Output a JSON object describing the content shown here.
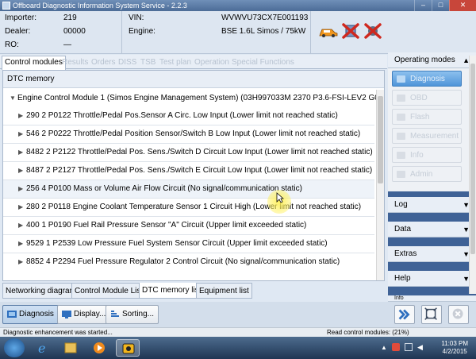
{
  "window": {
    "title": "Offboard Diagnostic Information System Service - 2.2.3",
    "minimize": "–",
    "maximize": "□",
    "close": "✕"
  },
  "header": {
    "importer_label": "Importer:",
    "importer_value": "219",
    "dealer_label": "Dealer:",
    "dealer_value": "00000",
    "ro_label": "RO:",
    "ro_value": "—",
    "vin_label": "VIN:",
    "vin_value": "WVWVU73CX7E001193",
    "engine_label": "Engine:",
    "engine_value": "BSE 1.6L Simos / 75kW"
  },
  "tabs": [
    {
      "label": "Control modules",
      "active": true
    },
    {
      "label": "Results",
      "active": false
    },
    {
      "label": "Orders",
      "active": false
    },
    {
      "label": "DISS",
      "active": false
    },
    {
      "label": "TSB",
      "active": false
    },
    {
      "label": "Test plan",
      "active": false
    },
    {
      "label": "Operation",
      "active": false
    },
    {
      "label": "Special Functions",
      "active": false
    }
  ],
  "main": {
    "section_title": "DTC memory",
    "module": "Engine Control Module 1 (Simos Engine Management System) (03H997033M      2370   P3.6-FSI-LEV2  G00",
    "dtcs": [
      {
        "text": "290  2   P0122   Throttle/Pedal Pos.Sensor A Circ. Low Input  (Lower limit not reached   static)"
      },
      {
        "text": "546  2   P0222   Throttle/Pedal Position Sensor/Switch B          Low Input  (Lower limit not reached   static)"
      },
      {
        "text": "8482  2   P2122   Throttle/Pedal Pos. Sens./Switch D Circuit Low Input  (Lower limit not reached   static)"
      },
      {
        "text": "8487  2   P2127   Throttle/Pedal Pos. Sens./Switch E Circuit Low Input  (Lower limit not reached   static)"
      },
      {
        "text": "256   4   P0100   Mass or Volume Air Flow Circuit  (No signal/communication   static)"
      },
      {
        "text": "280  2   P0118   Engine Coolant Temperature Sensor 1 Circuit High  (Lower limit not reached   static)"
      },
      {
        "text": "400  1   P0190   Fuel Rail Pressure Sensor \"A\" Circuit  (Upper limit exceeded   static)"
      },
      {
        "text": "9529  1   P2539   Low Pressure Fuel System Sensor Circuit  (Upper limit exceeded   static)"
      },
      {
        "text": "8852  4   P2294   Fuel Pressure Regulator 2 Control Circuit  (No signal/communication   static)"
      }
    ]
  },
  "bottom_tabs": [
    {
      "label": "Networking diagram",
      "active": false
    },
    {
      "label": "Control Module List",
      "active": false
    },
    {
      "label": "DTC memory list",
      "active": true
    },
    {
      "label": "Equipment list",
      "active": false
    }
  ],
  "buttons": {
    "diagnosis": "Diagnosis",
    "display": "Display...",
    "sorting": "Sorting..."
  },
  "right_panel": {
    "operating_modes": "Operating modes",
    "modes": [
      {
        "label": "Diagnosis",
        "active": true
      },
      {
        "label": "OBD",
        "active": false
      },
      {
        "label": "Flash",
        "active": false
      },
      {
        "label": "Measurement",
        "active": false
      },
      {
        "label": "Info",
        "active": false
      },
      {
        "label": "Admin",
        "active": false
      }
    ],
    "sections": [
      "Log",
      "Data",
      "Extras",
      "Help",
      "Info"
    ]
  },
  "status": {
    "left": "Diagnostic enhancement was started...",
    "right": "Read control modules: (21%)"
  },
  "taskbar": {
    "time": "11:03 PM",
    "date": "4/2/2015"
  },
  "colors": {
    "accent": "#4f95d9",
    "panel_dark": "#3f6296",
    "error_red": "#d0281e"
  }
}
